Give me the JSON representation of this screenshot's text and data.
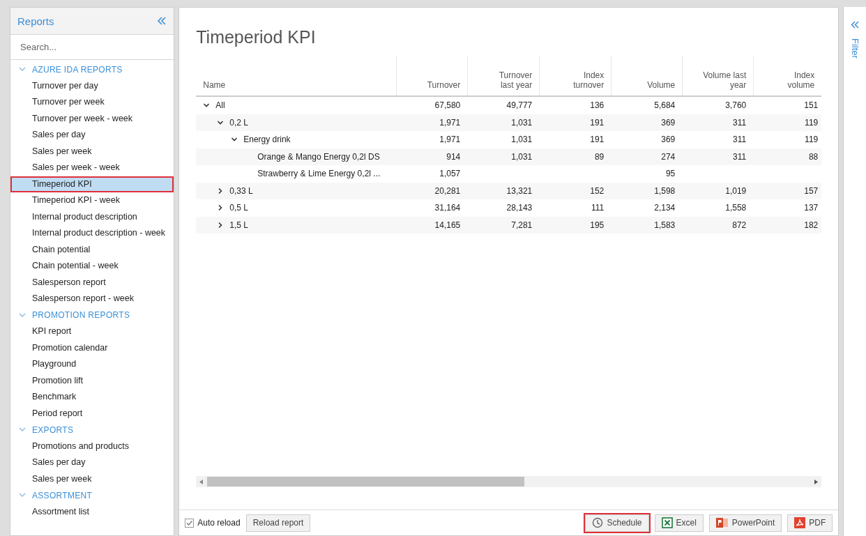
{
  "sidebar": {
    "title": "Reports",
    "search": {
      "placeholder": "Search..."
    },
    "sections": [
      {
        "title": "AZURE IDA REPORTS",
        "expanded": true,
        "items": [
          {
            "label": "Turnover per day",
            "selected": false
          },
          {
            "label": "Turnover per week",
            "selected": false
          },
          {
            "label": "Turnover per week - week",
            "selected": false
          },
          {
            "label": "Sales per day",
            "selected": false
          },
          {
            "label": "Sales per week",
            "selected": false
          },
          {
            "label": "Sales per week - week",
            "selected": false
          },
          {
            "label": "Timeperiod KPI",
            "selected": true
          },
          {
            "label": "Timeperiod KPI - week",
            "selected": false
          },
          {
            "label": "Internal product description",
            "selected": false
          },
          {
            "label": "Internal product description - week",
            "selected": false
          },
          {
            "label": "Chain potential",
            "selected": false
          },
          {
            "label": "Chain potential - week",
            "selected": false
          },
          {
            "label": "Salesperson report",
            "selected": false
          },
          {
            "label": "Salesperson report - week",
            "selected": false
          }
        ]
      },
      {
        "title": "PROMOTION REPORTS",
        "expanded": true,
        "items": [
          {
            "label": "KPI report",
            "selected": false
          },
          {
            "label": "Promotion calendar",
            "selected": false
          },
          {
            "label": "Playground",
            "selected": false
          },
          {
            "label": "Promotion lift",
            "selected": false
          },
          {
            "label": "Benchmark",
            "selected": false
          },
          {
            "label": "Period report",
            "selected": false
          }
        ]
      },
      {
        "title": "EXPORTS",
        "expanded": true,
        "items": [
          {
            "label": "Promotions and products",
            "selected": false
          },
          {
            "label": "Sales per day",
            "selected": false
          },
          {
            "label": "Sales per week",
            "selected": false
          }
        ]
      },
      {
        "title": "ASSORTMENT",
        "expanded": true,
        "items": [
          {
            "label": "Assortment list",
            "selected": false
          }
        ]
      }
    ]
  },
  "report": {
    "title": "Timeperiod KPI",
    "table": {
      "columns": [
        "Name",
        "Turnover",
        "Turnover last year",
        "Index turnover",
        "Volume",
        "Volume last year",
        "Index volume"
      ],
      "rows": [
        {
          "name": "All",
          "expanded": true,
          "turnover": "67,580",
          "turnover_last_year": "49,777",
          "index_turnover": "136",
          "volume": "5,684",
          "volume_last_year": "3,760",
          "index_volume": "151",
          "children": [
            {
              "name": "0,2 L",
              "expanded": true,
              "turnover": "1,971",
              "turnover_last_year": "1,031",
              "index_turnover": "191",
              "volume": "369",
              "volume_last_year": "311",
              "index_volume": "119",
              "children": [
                {
                  "name": "Energy drink",
                  "expanded": true,
                  "turnover": "1,971",
                  "turnover_last_year": "1,031",
                  "index_turnover": "191",
                  "volume": "369",
                  "volume_last_year": "311",
                  "index_volume": "119",
                  "children": [
                    {
                      "name": "Orange & Mango Energy 0,2l DS",
                      "turnover": "914",
                      "turnover_last_year": "1,031",
                      "index_turnover": "89",
                      "volume": "274",
                      "volume_last_year": "311",
                      "index_volume": "88"
                    },
                    {
                      "name": "Strawberry & Lime Energy 0,2l ...",
                      "turnover": "1,057",
                      "volume": "95"
                    }
                  ]
                }
              ]
            },
            {
              "name": "0,33 L",
              "expanded": false,
              "turnover": "20,281",
              "turnover_last_year": "13,321",
              "index_turnover": "152",
              "volume": "1,598",
              "volume_last_year": "1,019",
              "index_volume": "157"
            },
            {
              "name": "0,5 L",
              "expanded": false,
              "turnover": "31,164",
              "turnover_last_year": "28,143",
              "index_turnover": "111",
              "volume": "2,134",
              "volume_last_year": "1,558",
              "index_volume": "137"
            },
            {
              "name": "1,5 L",
              "expanded": false,
              "turnover": "14,165",
              "turnover_last_year": "7,281",
              "index_turnover": "195",
              "volume": "1,583",
              "volume_last_year": "872",
              "index_volume": "182"
            }
          ]
        }
      ]
    }
  },
  "footer": {
    "auto_reload": {
      "label": "Auto reload",
      "checked": true
    },
    "reload_button": "Reload report",
    "buttons": [
      {
        "kind": "schedule",
        "label": "Schedule",
        "highlighted": true
      },
      {
        "kind": "excel",
        "label": "Excel",
        "highlighted": false
      },
      {
        "kind": "powerpoint",
        "label": "PowerPoint",
        "highlighted": false
      },
      {
        "kind": "pdf",
        "label": "PDF",
        "highlighted": false
      }
    ]
  },
  "filter_panel": {
    "label": "Filter"
  }
}
